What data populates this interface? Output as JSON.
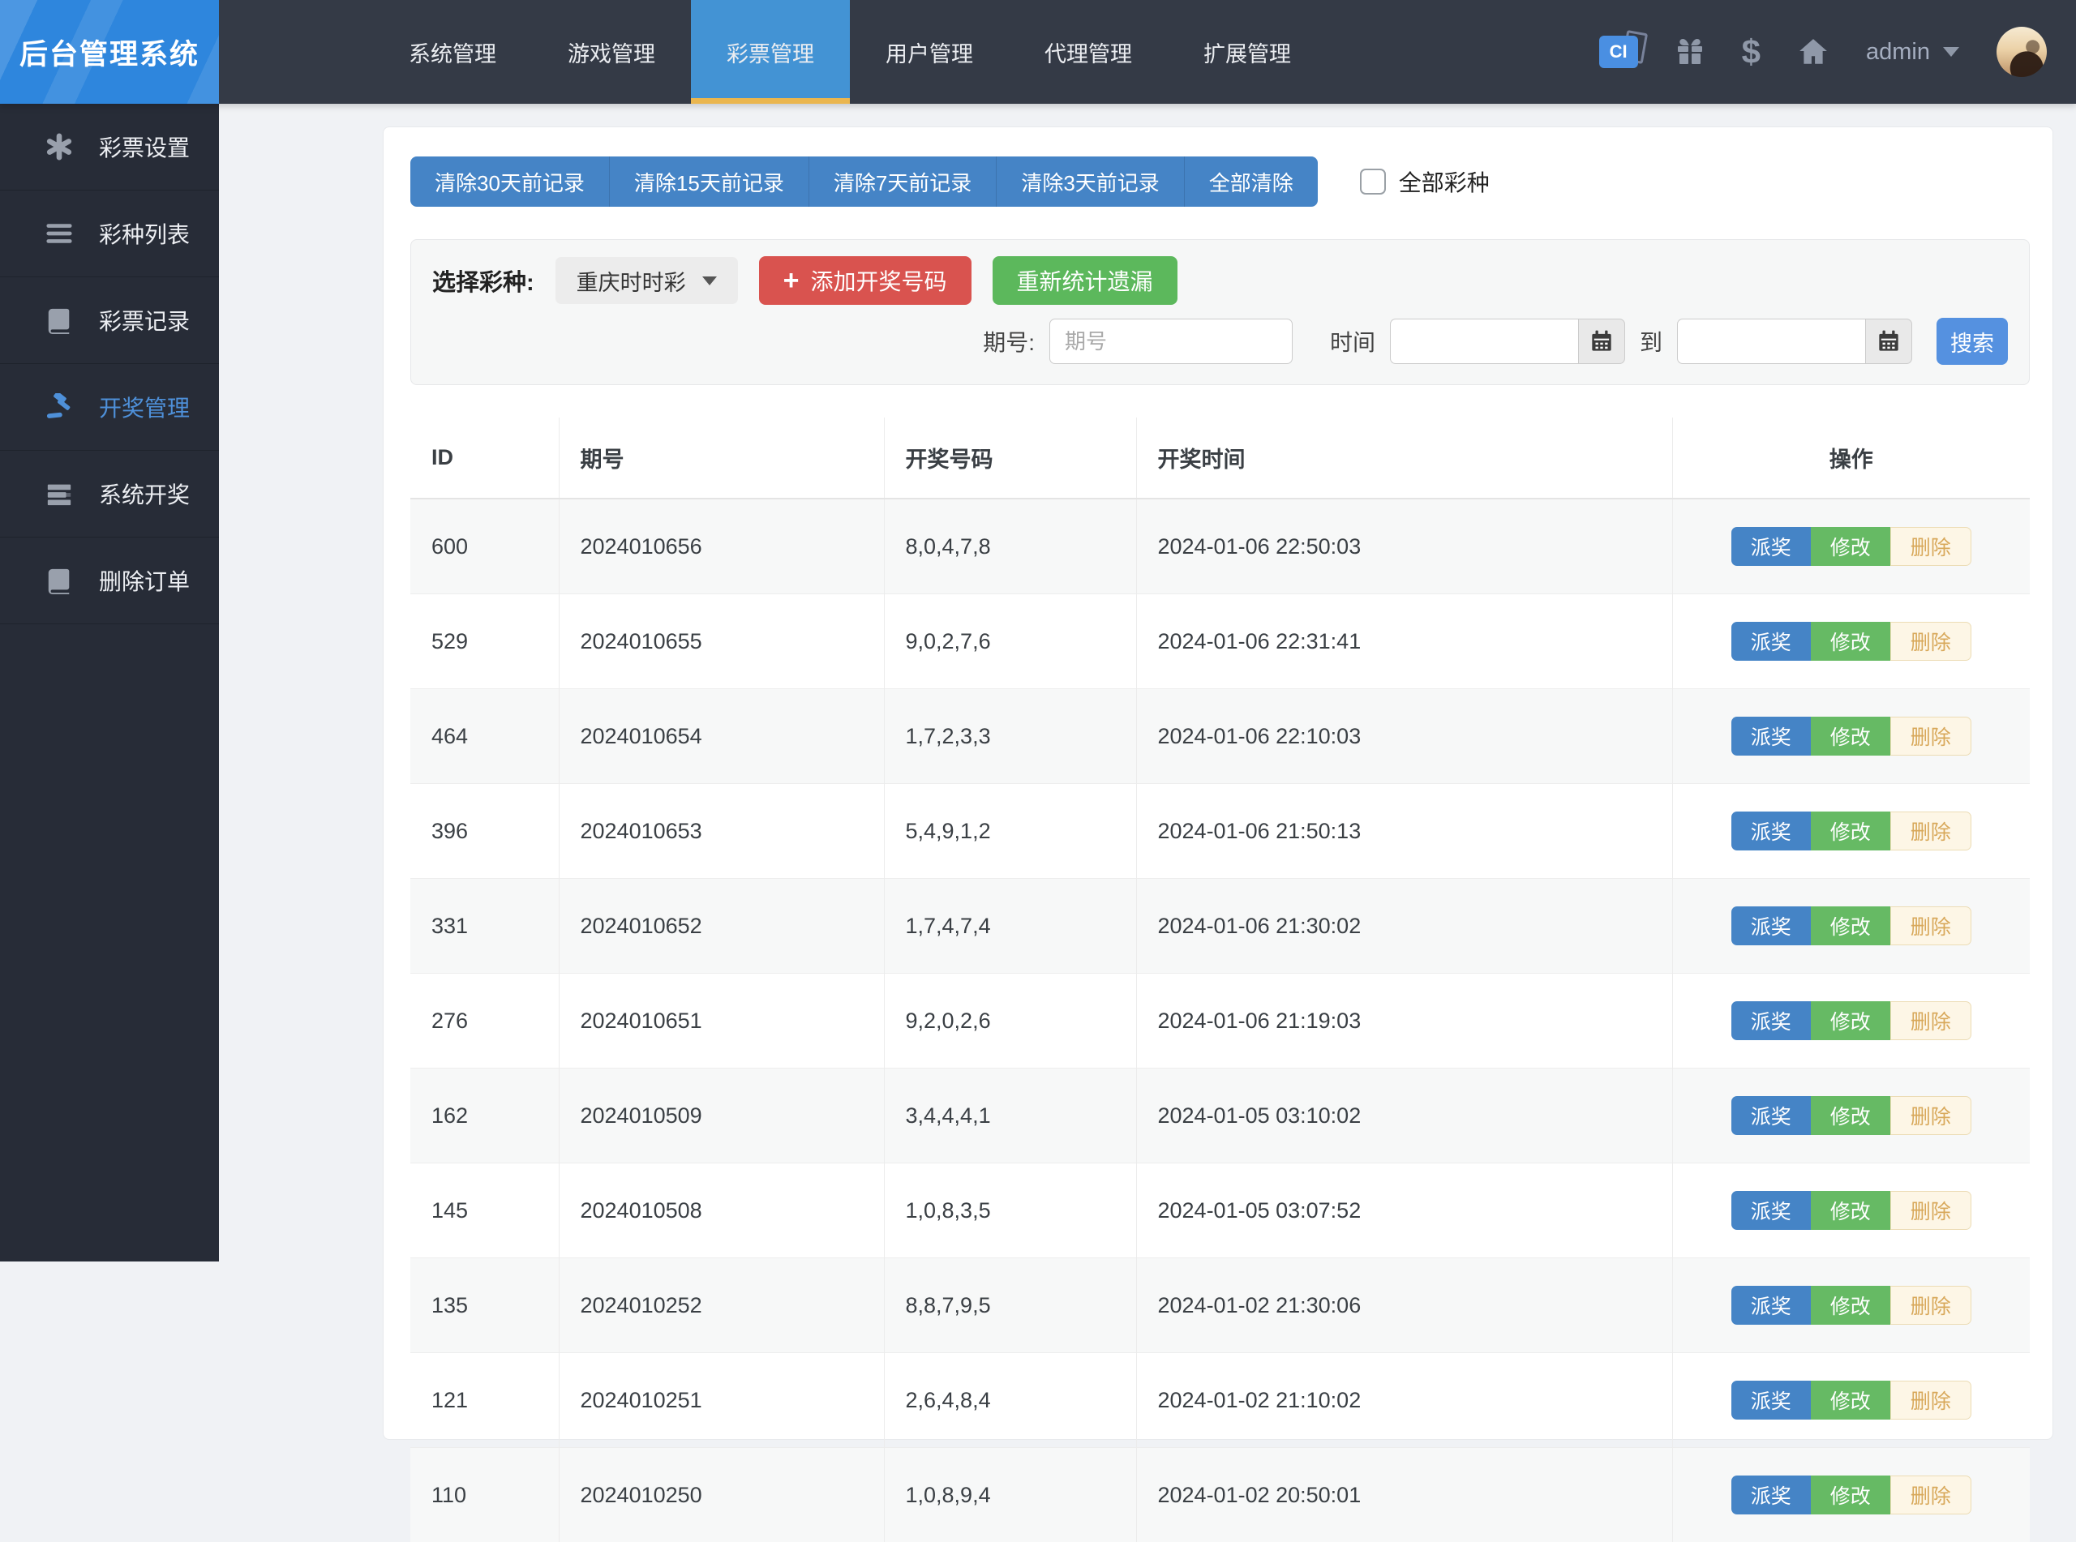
{
  "app": {
    "title": "后台管理系统"
  },
  "topnav": {
    "tabs": [
      {
        "label": "系统管理",
        "active": false
      },
      {
        "label": "游戏管理",
        "active": false
      },
      {
        "label": "彩票管理",
        "active": true
      },
      {
        "label": "用户管理",
        "active": false
      },
      {
        "label": "代理管理",
        "active": false
      },
      {
        "label": "扩展管理",
        "active": false
      }
    ],
    "icons": [
      "ci",
      "gift",
      "dollar",
      "home"
    ],
    "user": "admin"
  },
  "sidebar": {
    "items": [
      {
        "label": "彩票设置",
        "icon": "asterisk",
        "active": false
      },
      {
        "label": "彩种列表",
        "icon": "list",
        "active": false
      },
      {
        "label": "彩票记录",
        "icon": "book",
        "active": false
      },
      {
        "label": "开奖管理",
        "icon": "gavel",
        "active": true
      },
      {
        "label": "系统开奖",
        "icon": "tasks",
        "active": false
      },
      {
        "label": "删除订单",
        "icon": "book",
        "active": false
      }
    ]
  },
  "toolbar": {
    "clear_buttons": [
      "清除30天前记录",
      "清除15天前记录",
      "清除7天前记录",
      "清除3天前记录",
      "全部清除"
    ],
    "all_lottery_label": "全部彩种",
    "all_lottery_checked": false
  },
  "filters": {
    "select_label": "选择彩种:",
    "selected_lottery": "重庆时时彩",
    "add_button": "添加开奖号码",
    "recount_button": "重新统计遗漏",
    "issue_label": "期号:",
    "issue_placeholder": "期号",
    "time_label": "时间",
    "to_label": "到",
    "search_button": "搜索"
  },
  "colors": {
    "nav_bg": "#343a46",
    "logo_bg": "#2e86dd",
    "active_tab": "#4393d4",
    "active_tab_underline": "#eab64f",
    "sidebar_bg": "#272c37",
    "active_item": "#4e90d9",
    "primary_btn": "#4584c6",
    "danger_btn": "#d9534f",
    "success_btn": "#5cb85c",
    "search_btn": "#5591e0",
    "delete_btn_bg": "#fdf6e6",
    "delete_btn_text": "#d8a85a"
  },
  "table": {
    "headers": [
      "ID",
      "期号",
      "开奖号码",
      "开奖时间",
      "操作"
    ],
    "actions": [
      "派奖",
      "修改",
      "删除"
    ],
    "rows": [
      {
        "id": "600",
        "issue": "2024010656",
        "numbers": "8,0,4,7,8",
        "time": "2024-01-06 22:50:03"
      },
      {
        "id": "529",
        "issue": "2024010655",
        "numbers": "9,0,2,7,6",
        "time": "2024-01-06 22:31:41"
      },
      {
        "id": "464",
        "issue": "2024010654",
        "numbers": "1,7,2,3,3",
        "time": "2024-01-06 22:10:03"
      },
      {
        "id": "396",
        "issue": "2024010653",
        "numbers": "5,4,9,1,2",
        "time": "2024-01-06 21:50:13"
      },
      {
        "id": "331",
        "issue": "2024010652",
        "numbers": "1,7,4,7,4",
        "time": "2024-01-06 21:30:02"
      },
      {
        "id": "276",
        "issue": "2024010651",
        "numbers": "9,2,0,2,6",
        "time": "2024-01-06 21:19:03"
      },
      {
        "id": "162",
        "issue": "2024010509",
        "numbers": "3,4,4,4,1",
        "time": "2024-01-05 03:10:02"
      },
      {
        "id": "145",
        "issue": "2024010508",
        "numbers": "1,0,8,3,5",
        "time": "2024-01-05 03:07:52"
      },
      {
        "id": "135",
        "issue": "2024010252",
        "numbers": "8,8,7,9,5",
        "time": "2024-01-02 21:30:06"
      },
      {
        "id": "121",
        "issue": "2024010251",
        "numbers": "2,6,4,8,4",
        "time": "2024-01-02 21:10:02"
      },
      {
        "id": "110",
        "issue": "2024010250",
        "numbers": "1,0,8,9,4",
        "time": "2024-01-02 20:50:01"
      }
    ]
  }
}
